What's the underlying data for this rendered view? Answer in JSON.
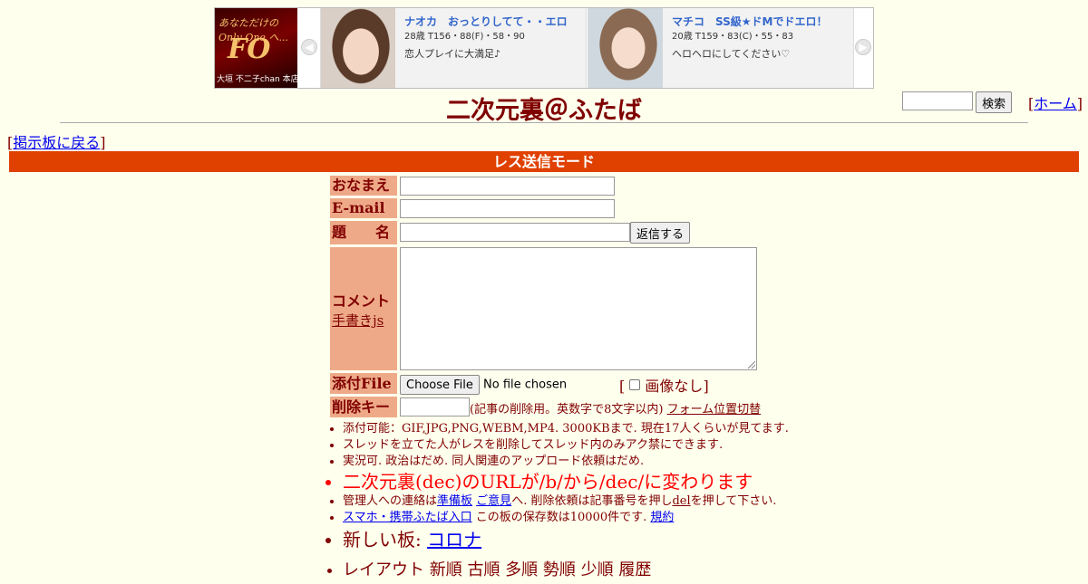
{
  "ad": {
    "logo": {
      "line1": "あなただけの Only One へ...",
      "brand": "FO",
      "line2": "大垣 不二子chan 本店"
    },
    "cards": [
      {
        "name": "ナオカ　おっとりしてて・・エロ",
        "spec": "28歳 T156・88(F)・58・90",
        "message": "恋人プレイに大満足♪"
      },
      {
        "name": "マチコ　SS級★ドMでドエロ！",
        "spec": "20歳 T159・83(C)・55・83",
        "message": "ヘロヘロにしてください♡"
      }
    ]
  },
  "header": {
    "title": "二次元裏＠ふたば",
    "search_button": "検索",
    "home_link": "ホーム"
  },
  "nav": {
    "back_link": "掲示板に戻る"
  },
  "mode_bar": "レス送信モード",
  "form": {
    "name_label": "おなまえ",
    "email_label": "E-mail",
    "subject_label": "題　　名",
    "submit_button": "返信する",
    "comment_label": "コメント",
    "tegaki_link": "手書きjs",
    "file_label": "添付File",
    "choose_file_button": "Choose File",
    "no_file_text": "No file chosen",
    "no_image_label": "画像なし",
    "delete_key_label": "削除キー",
    "delete_key_note": "(記事の削除用。英数字で8文字以内)",
    "form_position_link": "フォーム位置切替"
  },
  "notes": {
    "n1": "添付可能：GIF,JPG,PNG,WEBM,MP4. 3000KBまで. 現在17人くらいが見てます.",
    "n2": "スレッドを立てた人がレスを削除してスレッド内のみアク禁にできます.",
    "n3": "実況可. 政治はだめ. 同人関連のアップロード依頼はだめ.",
    "n4": "二次元裏(dec)のURLが/b/から/dec/に変わります",
    "n5_pre": "管理人への連絡は",
    "n5_link1": "準備板",
    "n5_link2": "ご意見",
    "n5_mid": "へ. 削除依頼は記事番号を押し",
    "n5_link3": "del",
    "n5_post": "を押して下さい.",
    "n6_link": "スマホ・携帯ふたば入口",
    "n6_mid": " この板の保存数は10000件です. ",
    "n6_link2": "規約",
    "n7_pre": "新しい板: ",
    "n7_link": "コロナ",
    "n8": "レイアウト 新順 古順 多順 勢順 少順 履歴"
  },
  "colors": {
    "background": "#ffffee",
    "text": "#800000",
    "mode_bar": "#e04000",
    "label_bg": "#eeaa88",
    "alert": "#ff0000",
    "link": "#0000ee"
  }
}
